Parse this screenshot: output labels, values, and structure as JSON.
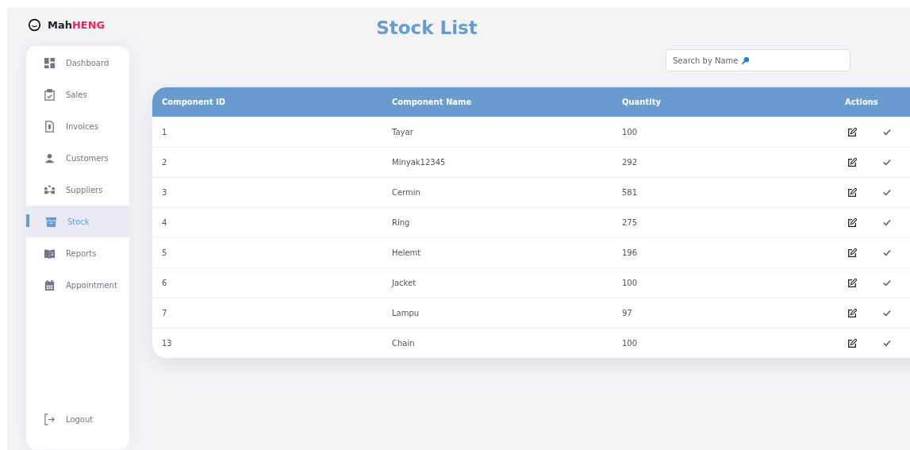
{
  "brand": {
    "part_1": "Mah",
    "part_2": "HENG"
  },
  "sidebar": {
    "items": [
      {
        "label": "Dashboard",
        "selected": false
      },
      {
        "label": "Sales",
        "selected": false
      },
      {
        "label": "Invoices",
        "selected": false
      },
      {
        "label": "Customers",
        "selected": false
      },
      {
        "label": "Suppliers",
        "selected": false
      },
      {
        "label": "Stock",
        "selected": true
      },
      {
        "label": "Reports",
        "selected": false
      },
      {
        "label": "Appointment",
        "selected": false
      }
    ],
    "logout": "Logout"
  },
  "title": "Stock List",
  "search": {
    "placeholder": "Search by Name"
  },
  "table": {
    "columns": [
      "Component ID",
      "Component Name",
      "Quantity",
      "Actions"
    ],
    "rows": [
      {
        "id": "1",
        "name": "Tayar",
        "quantity": "100"
      },
      {
        "id": "2",
        "name": "Minyak12345",
        "quantity": "292"
      },
      {
        "id": "3",
        "name": "Cermin",
        "quantity": "581"
      },
      {
        "id": "4",
        "name": "Ring",
        "quantity": "275"
      },
      {
        "id": "5",
        "name": "Helemt",
        "quantity": "196"
      },
      {
        "id": "6",
        "name": "Jacket",
        "quantity": "100"
      },
      {
        "id": "7",
        "name": "Lampu",
        "quantity": "97"
      },
      {
        "id": "13",
        "name": "Chain",
        "quantity": "100"
      }
    ]
  }
}
